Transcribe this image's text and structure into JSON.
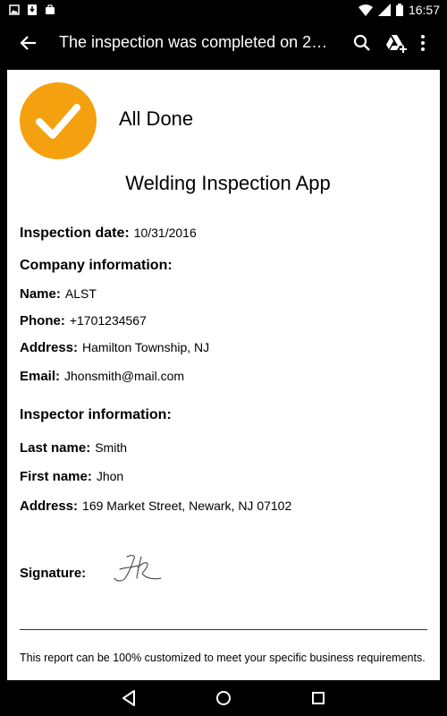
{
  "status_bar": {
    "time": "16:57",
    "icons_left": [
      "image-icon",
      "download-icon",
      "briefcase-icon"
    ],
    "icons_right": [
      "wifi-icon",
      "cellular-icon",
      "battery-icon"
    ]
  },
  "app_bar": {
    "title": "The inspection was completed on 2016...",
    "icons": [
      "back-arrow-icon",
      "search-icon",
      "drive-add-icon",
      "more-vert-icon"
    ]
  },
  "report": {
    "status": "All Done",
    "app_name": "Welding Inspection App",
    "inspection_date": {
      "label": "Inspection date:",
      "value": "10/31/2016"
    },
    "company": {
      "heading": "Company information:",
      "name": {
        "label": "Name:",
        "value": "ALST"
      },
      "phone": {
        "label": "Phone:",
        "value": "+1701234567"
      },
      "address": {
        "label": "Address:",
        "value": "Hamilton Township, NJ"
      },
      "email": {
        "label": "Email:",
        "value": "Jhonsmith@mail.com"
      }
    },
    "inspector": {
      "heading": "Inspector information:",
      "last_name": {
        "label": "Last name:",
        "value": "Smith"
      },
      "first_name": {
        "label": "First name:",
        "value": "Jhon"
      },
      "address": {
        "label": "Address:",
        "value": "169 Market Street, Newark, NJ 07102"
      }
    },
    "signature_label": "Signature:",
    "footer": "This report can be 100% customized to meet your specific business requirements."
  },
  "nav_bar": {
    "icons": [
      "back-triangle-icon",
      "home-circle-icon",
      "recents-square-icon"
    ]
  },
  "colors": {
    "accent": "#F5A00E",
    "bar_background": "#000000",
    "page_background": "#FFFFFF"
  }
}
